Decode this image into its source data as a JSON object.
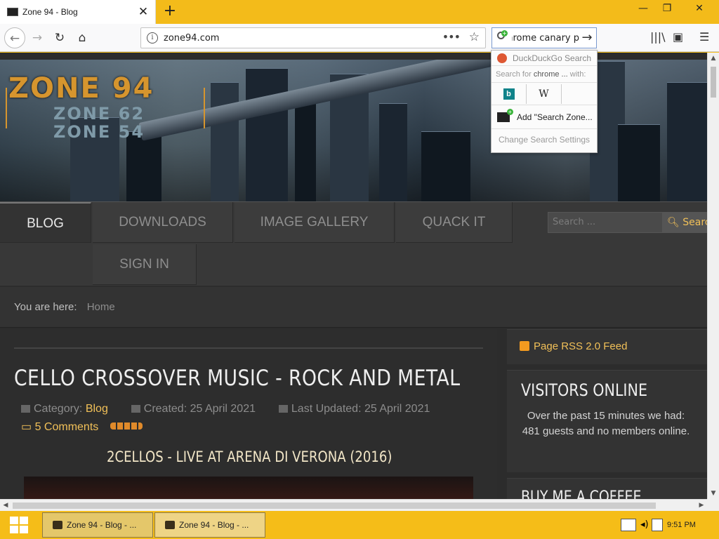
{
  "browser": {
    "tab_title": "Zone 94 - Blog",
    "new_tab_label": "+",
    "url": "zone94.com",
    "search_query": "chrome canary p",
    "window_controls": {
      "minimize": "—",
      "maximize": "❐",
      "close": "✕"
    }
  },
  "search_popup": {
    "engine_name": "DuckDuckGo Search",
    "search_for_prefix": "Search for",
    "search_for_term": "chrome ...",
    "search_for_suffix": "with:",
    "engines": [
      "b",
      "W"
    ],
    "add_engine_label": "Add \"Search Zone...",
    "change_settings_label": "Change Search Settings"
  },
  "site": {
    "logo_main": "ZONE 94",
    "logo_sub1": "ZONE 62",
    "logo_sub2": "ZONE 54",
    "menu": [
      {
        "label": "BLOG",
        "active": true
      },
      {
        "label": "DOWNLOADS"
      },
      {
        "label": "IMAGE GALLERY"
      },
      {
        "label": "QUACK IT"
      },
      {
        "label": "SIGN IN"
      }
    ],
    "search_placeholder": "Search ...",
    "search_button": "Search",
    "breadcrumb_label": "You are here:",
    "breadcrumb_home": "Home"
  },
  "article": {
    "title": "CELLO CROSSOVER MUSIC - ROCK AND METAL",
    "category_label": "Category:",
    "category": "Blog",
    "created": "Created: 25 April 2021",
    "updated": "Last Updated: 25 April 2021",
    "comments": "5 Comments",
    "video_title": "2CELLOS - LIVE AT ARENA DI VERONA (2016)"
  },
  "sidebar": {
    "rss": "Page RSS 2.0 Feed",
    "visitors_title": "VISITORS ONLINE",
    "visitors_text": "Over the past 15 minutes we had: 481 guests and no members online.",
    "coffee_title": "BUY ME A COFFEE"
  },
  "taskbar": {
    "tasks": [
      "Zone 94 - Blog - ...",
      "Zone 94 - Blog - ..."
    ],
    "time": "9:51 PM"
  },
  "colors": {
    "accent": "#f5bd18",
    "link_gold": "#f1c058",
    "page_bg": "#2c2c2c"
  }
}
